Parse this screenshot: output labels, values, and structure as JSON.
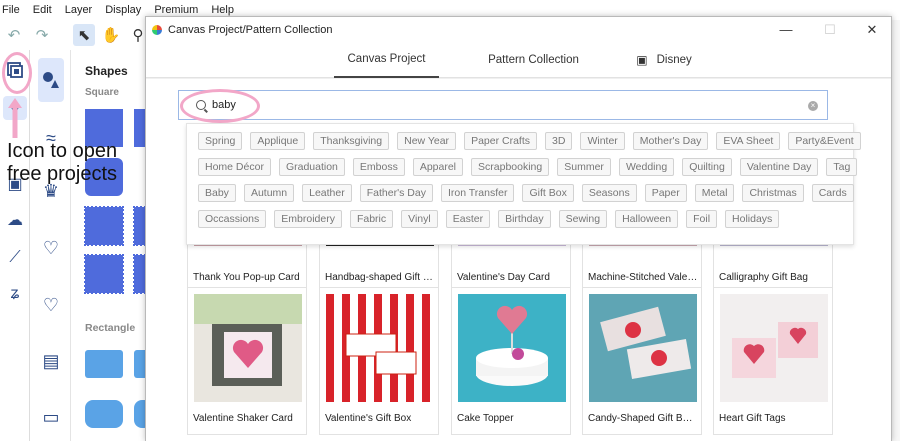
{
  "menu": [
    "File",
    "Edit",
    "Layer",
    "Display",
    "Premium",
    "Help"
  ],
  "shapes_panel": {
    "title": "Shapes",
    "section_square": "Square",
    "section_rectangle": "Rectangle"
  },
  "annotation": {
    "line1": "Icon to open",
    "line2": "free projects"
  },
  "dialog": {
    "title": "Canvas Project/Pattern Collection",
    "minimize": "—",
    "maximize": "☐",
    "close": "✕",
    "tabs": [
      {
        "label": "Canvas Project",
        "active": true
      },
      {
        "label": "Pattern Collection",
        "active": false
      },
      {
        "label": "Disney",
        "active": false
      }
    ],
    "search": {
      "value": "baby",
      "placeholder": ""
    },
    "tag_rows": [
      [
        "Spring",
        "Applique",
        "Thanksgiving",
        "New Year",
        "Paper Crafts",
        "3D",
        "Winter",
        "Mother's Day",
        "EVA Sheet",
        "Party&Event"
      ],
      [
        "Home Décor",
        "Graduation",
        "Emboss",
        "Apparel",
        "Scrapbooking",
        "Summer",
        "Wedding",
        "Quilting",
        "Valentine Day",
        "Tag"
      ],
      [
        "Baby",
        "Autumn",
        "Leather",
        "Father's Day",
        "Iron Transfer",
        "Gift Box",
        "Seasons",
        "Paper",
        "Metal",
        "Christmas",
        "Cards"
      ],
      [
        "Occassions",
        "Embroidery",
        "Fabric",
        "Vinyl",
        "Easter",
        "Birthday",
        "Sewing",
        "Halloween",
        "Foil",
        "Holidays"
      ]
    ],
    "cards_row1": [
      "Thank You Pop-up Card",
      "Handbag-shaped Gift Box",
      "Valentine's Day Card",
      "Machine-Stitched Valen...",
      "Calligraphy Gift Bag"
    ],
    "cards_row2": [
      "Valentine Shaker Card",
      "Valentine's Gift Box",
      "Cake Topper",
      "Candy-Shaped Gift Boxes",
      "Heart Gift Tags"
    ]
  },
  "colors": {
    "accent": "#4f6bdc",
    "annotation": "#f2a7c8",
    "rail_icon": "#2d4b86"
  }
}
